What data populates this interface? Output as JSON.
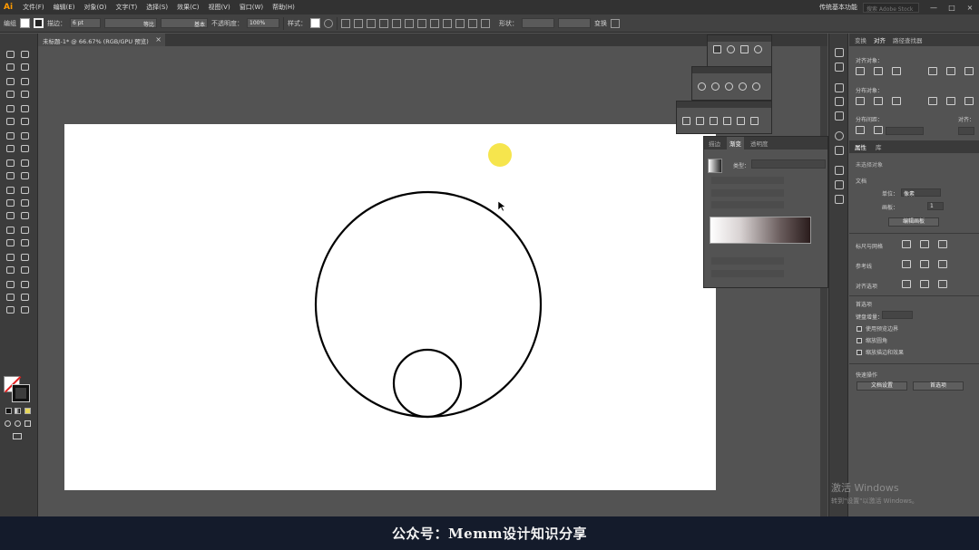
{
  "app": {
    "logo": "Ai",
    "workspace": "传统基本功能",
    "search_placeholder": "搜索 Adobe Stock"
  },
  "menu": [
    "文件(F)",
    "编辑(E)",
    "对象(O)",
    "文字(T)",
    "选择(S)",
    "效果(C)",
    "视图(V)",
    "窗口(W)",
    "帮助(H)"
  ],
  "window_controls": [
    "—",
    "□",
    "×"
  ],
  "control_bar": {
    "object_label": "编组",
    "stroke_label": "描边：",
    "stroke_value": "6 pt",
    "profile_value": "等比",
    "brush_value": "基本",
    "opacity_label": "不透明度：",
    "opacity_value": "100%",
    "style_label": "样式：",
    "shape_label": "形状：",
    "transform_label": "变换"
  },
  "document_tab": {
    "title": "未标题-1* @ 66.67% (RGB/GPU 预览)",
    "close": "×"
  },
  "gradient_panel": {
    "tabs": [
      "描边",
      "渐变",
      "透明度"
    ],
    "active_tab": "渐变",
    "type_label": "类型："
  },
  "right_panel": {
    "tabs": [
      "变换",
      "对齐",
      "路径查找器"
    ],
    "active_tab": "对齐",
    "align_objects_label": "对齐对象：",
    "distribute_objects_label": "分布对象：",
    "distribute_spacing_label": "分布间距：",
    "align_to_label": "对齐：",
    "props_tabs": [
      "属性",
      "库"
    ],
    "props_active": "属性",
    "no_selection": "未选择对象",
    "document_label": "文档",
    "units_label": "单位：",
    "units_value": "像素",
    "artboard_label": "画板：",
    "artboard_value": "1",
    "edit_artboard_button": "编辑画板",
    "rulers_grid_label": "标尺与网格",
    "guides_label": "参考线",
    "snap_label": "对齐选项",
    "preferences_label": "首选项",
    "keyboard_increment_label": "键盘增量：",
    "checkboxes": [
      "使用预览边界",
      "缩放圆角",
      "缩放描边和效果"
    ],
    "quick_actions_label": "快速操作",
    "doc_setup_button": "文档设置",
    "preferences_button": "首选项"
  },
  "watermark": {
    "line1": "激活 Windows",
    "line2": "转到\"设置\"以激活 Windows。"
  },
  "subtitle": "公众号：Memm设计知识分享",
  "colors": {
    "accent": "#ff9a00",
    "cursor_highlight": "#f5e23a",
    "subtitle_bg": "#141b2b"
  }
}
